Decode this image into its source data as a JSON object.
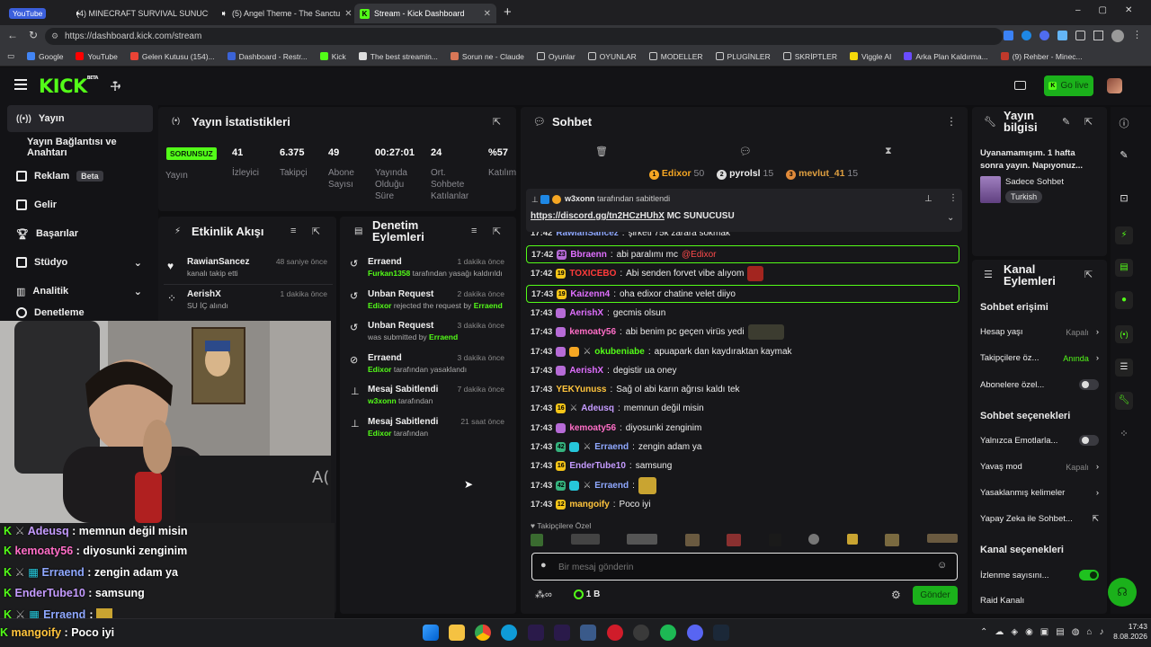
{
  "browser": {
    "tabs": [
      {
        "label": "YouTube",
        "type": "yt-badge"
      },
      {
        "label": "(4) MINECRAFT SURVIVAL SUNUCU",
        "type": "yt"
      },
      {
        "label": "(5) Angel Theme - The Sanctu",
        "type": "yt"
      },
      {
        "label": "Stream - Kick Dashboard",
        "type": "kick",
        "active": true
      }
    ],
    "url": "https://dashboard.kick.com/stream",
    "bookmarks": [
      "Google",
      "YouTube",
      "Gelen Kutusu (154)...",
      "Dashboard - Restr...",
      "Kick",
      "The best streamin...",
      "Sorun ne - Claude",
      "Oyunlar",
      "OYUNLAR",
      "MODELLER",
      "PLUGİNLER",
      "SKRİPTLER",
      "Viggle AI",
      "Arka Plan Kaldırma...",
      "(9) Rehber - Minec..."
    ],
    "bookmark_colors": [
      "#4285f4",
      "#ff0000",
      "#ea4335",
      "#3b63d6",
      "#53fc18",
      "#dddddd",
      "#d97757",
      "#dddddd",
      "#dddddd",
      "#dddddd",
      "#dddddd",
      "#dddddd",
      "#f5d90a",
      "#6a4cff",
      "#c0392b"
    ]
  },
  "header": {
    "logo": "KICK",
    "logo_sup": "BETA",
    "golive": "Go live"
  },
  "sidebar": {
    "items": [
      "Yayın",
      "Yayın Bağlantısı ve Anahtarı",
      "Reklam",
      "Gelir",
      "Başarılar",
      "Stüdyo",
      "Analitik",
      "Denetleme"
    ],
    "beta": "Beta"
  },
  "stats": {
    "title": "Yayın İstatistikleri",
    "status": "SORUNSUZ",
    "status_label": "Yayın",
    "cols": [
      {
        "value": "41",
        "label": "İzleyici"
      },
      {
        "value": "6.375",
        "label": "Takipçi"
      },
      {
        "value": "49",
        "label": "Abone Sayısı"
      },
      {
        "value": "00:27:01",
        "label": "Yayında Olduğu Süre"
      },
      {
        "value": "24",
        "label": "Ort. Sohbete Katılanlar"
      },
      {
        "value": "%57",
        "label": "Katılım"
      }
    ]
  },
  "events": {
    "title": "Etkinlik Akışı",
    "items": [
      {
        "name": "RawianSancez",
        "sub": "kanalı takip etti",
        "time": "48 saniye önce"
      },
      {
        "name": "AerishX",
        "sub": "SU İÇ alındı",
        "time": "1 dakika önce"
      }
    ]
  },
  "mod": {
    "title": "Denetim Eylemleri",
    "items": [
      {
        "name": "Erraend",
        "sub_user": "Furkan1358",
        "sub": "tarafından yasağı kaldırıldı",
        "time": "1 dakika önce"
      },
      {
        "name": "Unban Request",
        "sub_user": "Edixor",
        "sub": "rejected the request by",
        "sub_user2": "Erraend",
        "time": "2 dakika önce"
      },
      {
        "name": "Unban Request",
        "sub_user": "",
        "sub": "was submitted by",
        "sub_user2": "Erraend",
        "time": "3 dakika önce"
      },
      {
        "name": "Erraend",
        "sub_user": "Edixor",
        "sub": "tarafından yasaklandı",
        "time": "3 dakika önce"
      },
      {
        "name": "Mesaj Sabitlendi",
        "sub_user": "w3xonn",
        "sub": "tarafından",
        "time": "7 dakika önce"
      },
      {
        "name": "Mesaj Sabitlendi",
        "sub_user": "Edixor",
        "sub": "tarafından",
        "time": "21 saat önce"
      }
    ]
  },
  "chat": {
    "title": "Sohbet",
    "top_users": [
      {
        "name": "Edixor",
        "score": "50"
      },
      {
        "name": "pyrolsl",
        "score": "15"
      },
      {
        "name": "mevlut_41",
        "score": "15"
      }
    ],
    "pinned_by": "w3xonn",
    "pinned_label": "tarafından sabitlendi",
    "pinned_link": "https://discord.gg/tn2HCzHUhX",
    "pinned_text": "MC SUNUCUSU",
    "messages": [
      {
        "time": "17:42",
        "badge": "",
        "user": "RawianSancez",
        "color": "#8fa8ff",
        "text": "şirketi 75k zarara sokmak"
      },
      {
        "time": "17:42",
        "badge": "23",
        "user": "Bbraenn",
        "color": "#e06fff",
        "text": "abi paralımı mc",
        "mention": "@Edixor",
        "hl": true
      },
      {
        "time": "17:42",
        "badge": "19",
        "user": "TOXICEBO",
        "color": "#ff3b3b",
        "text": "Abi senden forvet vibe alıyom"
      },
      {
        "time": "17:43",
        "badge": "19",
        "user": "Kaizenn4",
        "color": "#e06fff",
        "text": "oha edixor chatine velet diiyo",
        "hl": true
      },
      {
        "time": "17:43",
        "badge": "",
        "user": "AerishX",
        "color": "#e06fff",
        "text": "gecmis olsun"
      },
      {
        "time": "17:43",
        "badge": "",
        "user": "kemoaty56",
        "color": "#ff6ec7",
        "text": "abi benim pc geçen virüs yedi"
      },
      {
        "time": "17:43",
        "badge": "",
        "user": "okubeniabe",
        "color": "#53fc18",
        "text": "apuapark dan kaydıraktan kaymak"
      },
      {
        "time": "17:43",
        "badge": "",
        "user": "AerishX",
        "color": "#e06fff",
        "text": "degistir ua oney"
      },
      {
        "time": "17:43",
        "badge": "",
        "user": "YEKYunuss",
        "color": "#ffc43d",
        "text": "Sağ ol abi karın ağrısı kaldı tek"
      },
      {
        "time": "17:43",
        "badge": "16",
        "user": "Adeusq",
        "color": "#c59bff",
        "text": "memnun değil misin"
      },
      {
        "time": "17:43",
        "badge": "",
        "user": "kemoaty56",
        "color": "#ff6ec7",
        "text": "diyosunki zenginim"
      },
      {
        "time": "17:43",
        "badge": "42",
        "user": "Erraend",
        "color": "#8fa8ff",
        "text": "zengin adam ya"
      },
      {
        "time": "17:43",
        "badge": "16",
        "user": "EnderTube10",
        "color": "#c59bff",
        "text": "samsung"
      },
      {
        "time": "17:43",
        "badge": "42",
        "user": "Erraend",
        "color": "#8fa8ff",
        "text": ""
      },
      {
        "time": "17:43",
        "badge": "12",
        "user": "mangoify",
        "color": "#ffc43d",
        "text": "Poco iyi"
      }
    ],
    "followers_only": "Takipçilere Özel",
    "input_placeholder": "Bir mesaj gönderin",
    "points": "1 B",
    "send": "Gönder"
  },
  "streaminfo": {
    "title": "Yayın bilgisi",
    "stream_title": "Uyanamamışım. 1 hafta sonra yayın. Napıyonuz...",
    "category": "Sadece Sohbet",
    "tag": "Turkish"
  },
  "channel": {
    "title": "Kanal Eylemleri",
    "chat_access": "Sohbet erişimi",
    "rows1": [
      {
        "label": "Hesap yaşı",
        "value": "Kapalı",
        "kind": "arrow"
      },
      {
        "label": "Takipçilere öz...",
        "value": "Anında",
        "kind": "arrow-green"
      },
      {
        "label": "Abonelere özel...",
        "value": "",
        "kind": "toggle-off"
      }
    ],
    "chat_options": "Sohbet seçenekleri",
    "rows2": [
      {
        "label": "Yalnızca Emotlarla...",
        "value": "",
        "kind": "toggle-off"
      },
      {
        "label": "Yavaş mod",
        "value": "Kapalı",
        "kind": "arrow"
      },
      {
        "label": "Yasaklanmış kelimeler",
        "value": "",
        "kind": "arrow"
      },
      {
        "label": "Yapay Zeka ile Sohbet...",
        "value": "",
        "kind": "external"
      }
    ],
    "channel_options": "Kanal seçenekleri",
    "rows3": [
      {
        "label": "İzlenme sayısını...",
        "value": "",
        "kind": "toggle-on"
      },
      {
        "label": "Raid Kanalı",
        "value": "",
        "kind": "none"
      }
    ]
  },
  "overlay": [
    {
      "user": "Adeusq",
      "color": "#c59bff",
      "text": "memnun değil misin"
    },
    {
      "user": "kemoaty56",
      "color": "#ff6ec7",
      "text": "diyosunki zenginim"
    },
    {
      "user": "Erraend",
      "color": "#8fa8ff",
      "text": "zengin adam ya"
    },
    {
      "user": "EnderTube10",
      "color": "#c59bff",
      "text": "samsung"
    },
    {
      "user": "Erraend",
      "color": "#8fa8ff",
      "text": ""
    },
    {
      "user": "mangoify",
      "color": "#ffc43d",
      "text": "Poco iyi"
    }
  ],
  "taskbar": {
    "time": "17:43",
    "date": "8.08.2026"
  },
  "colors": {
    "accent": "#53fc18",
    "panel": "#17171a",
    "bg": "#0f0f11"
  }
}
